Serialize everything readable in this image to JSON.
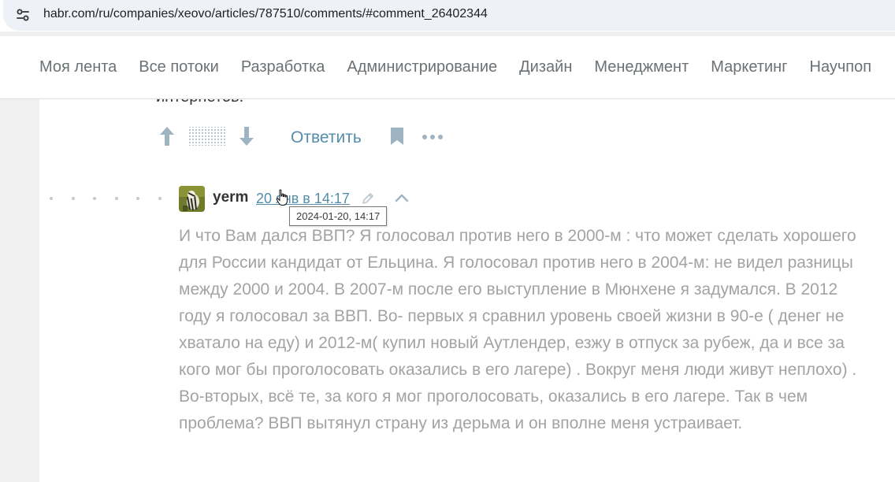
{
  "browser": {
    "url": "habr.com/ru/companies/xeovo/articles/787510/comments/#comment_26402344"
  },
  "nav": {
    "items": [
      "Моя лента",
      "Все потоки",
      "Разработка",
      "Администрирование",
      "Дизайн",
      "Менеджмент",
      "Маркетинг",
      "Научпоп"
    ]
  },
  "previous_comment": {
    "cut_text": "интернетов.",
    "reply_label": "Ответить"
  },
  "comment": {
    "username": "yerm",
    "date": "20 янв в 14:17",
    "tooltip": "2024-01-20, 14:17",
    "body": "И что Вам дался ВВП? Я голосовал против него в 2000-м : что может сделать хорошего для России кандидат от Ельцина. Я голосовал против него в 2004-м: не видел разницы между 2000 и 2004. В 2007-м после его выступление в Мюнхене я задумался. В 2012 году я голосовал за ВВП. Во- первых я сравнил уровень своей жизни в 90-е ( денег не хватало на еду) и 2012-м( купил новый Аутлендер, езжу в отпуск за рубеж, да и все за кого мог бы проголосовать оказались в его лагере) . Вокруг меня люди живут неплохо) . Во-вторых, всё те, за кого я мог проголосовать, оказались в его лагере. Так в чем проблема? ВВП вытянул страну из дерьма и он вполне меня устраивает."
  },
  "colors": {
    "link": "#548eaa",
    "nav_text": "#6b7174",
    "body_text": "#a3a3a3",
    "icon": "#9fb4c2"
  },
  "icons": [
    "site-info-icon",
    "upvote-icon",
    "rating-hidden-icon",
    "downvote-icon",
    "bookmark-icon",
    "more-icon",
    "edited-icon",
    "collapse-icon",
    "cursor-icon"
  ]
}
